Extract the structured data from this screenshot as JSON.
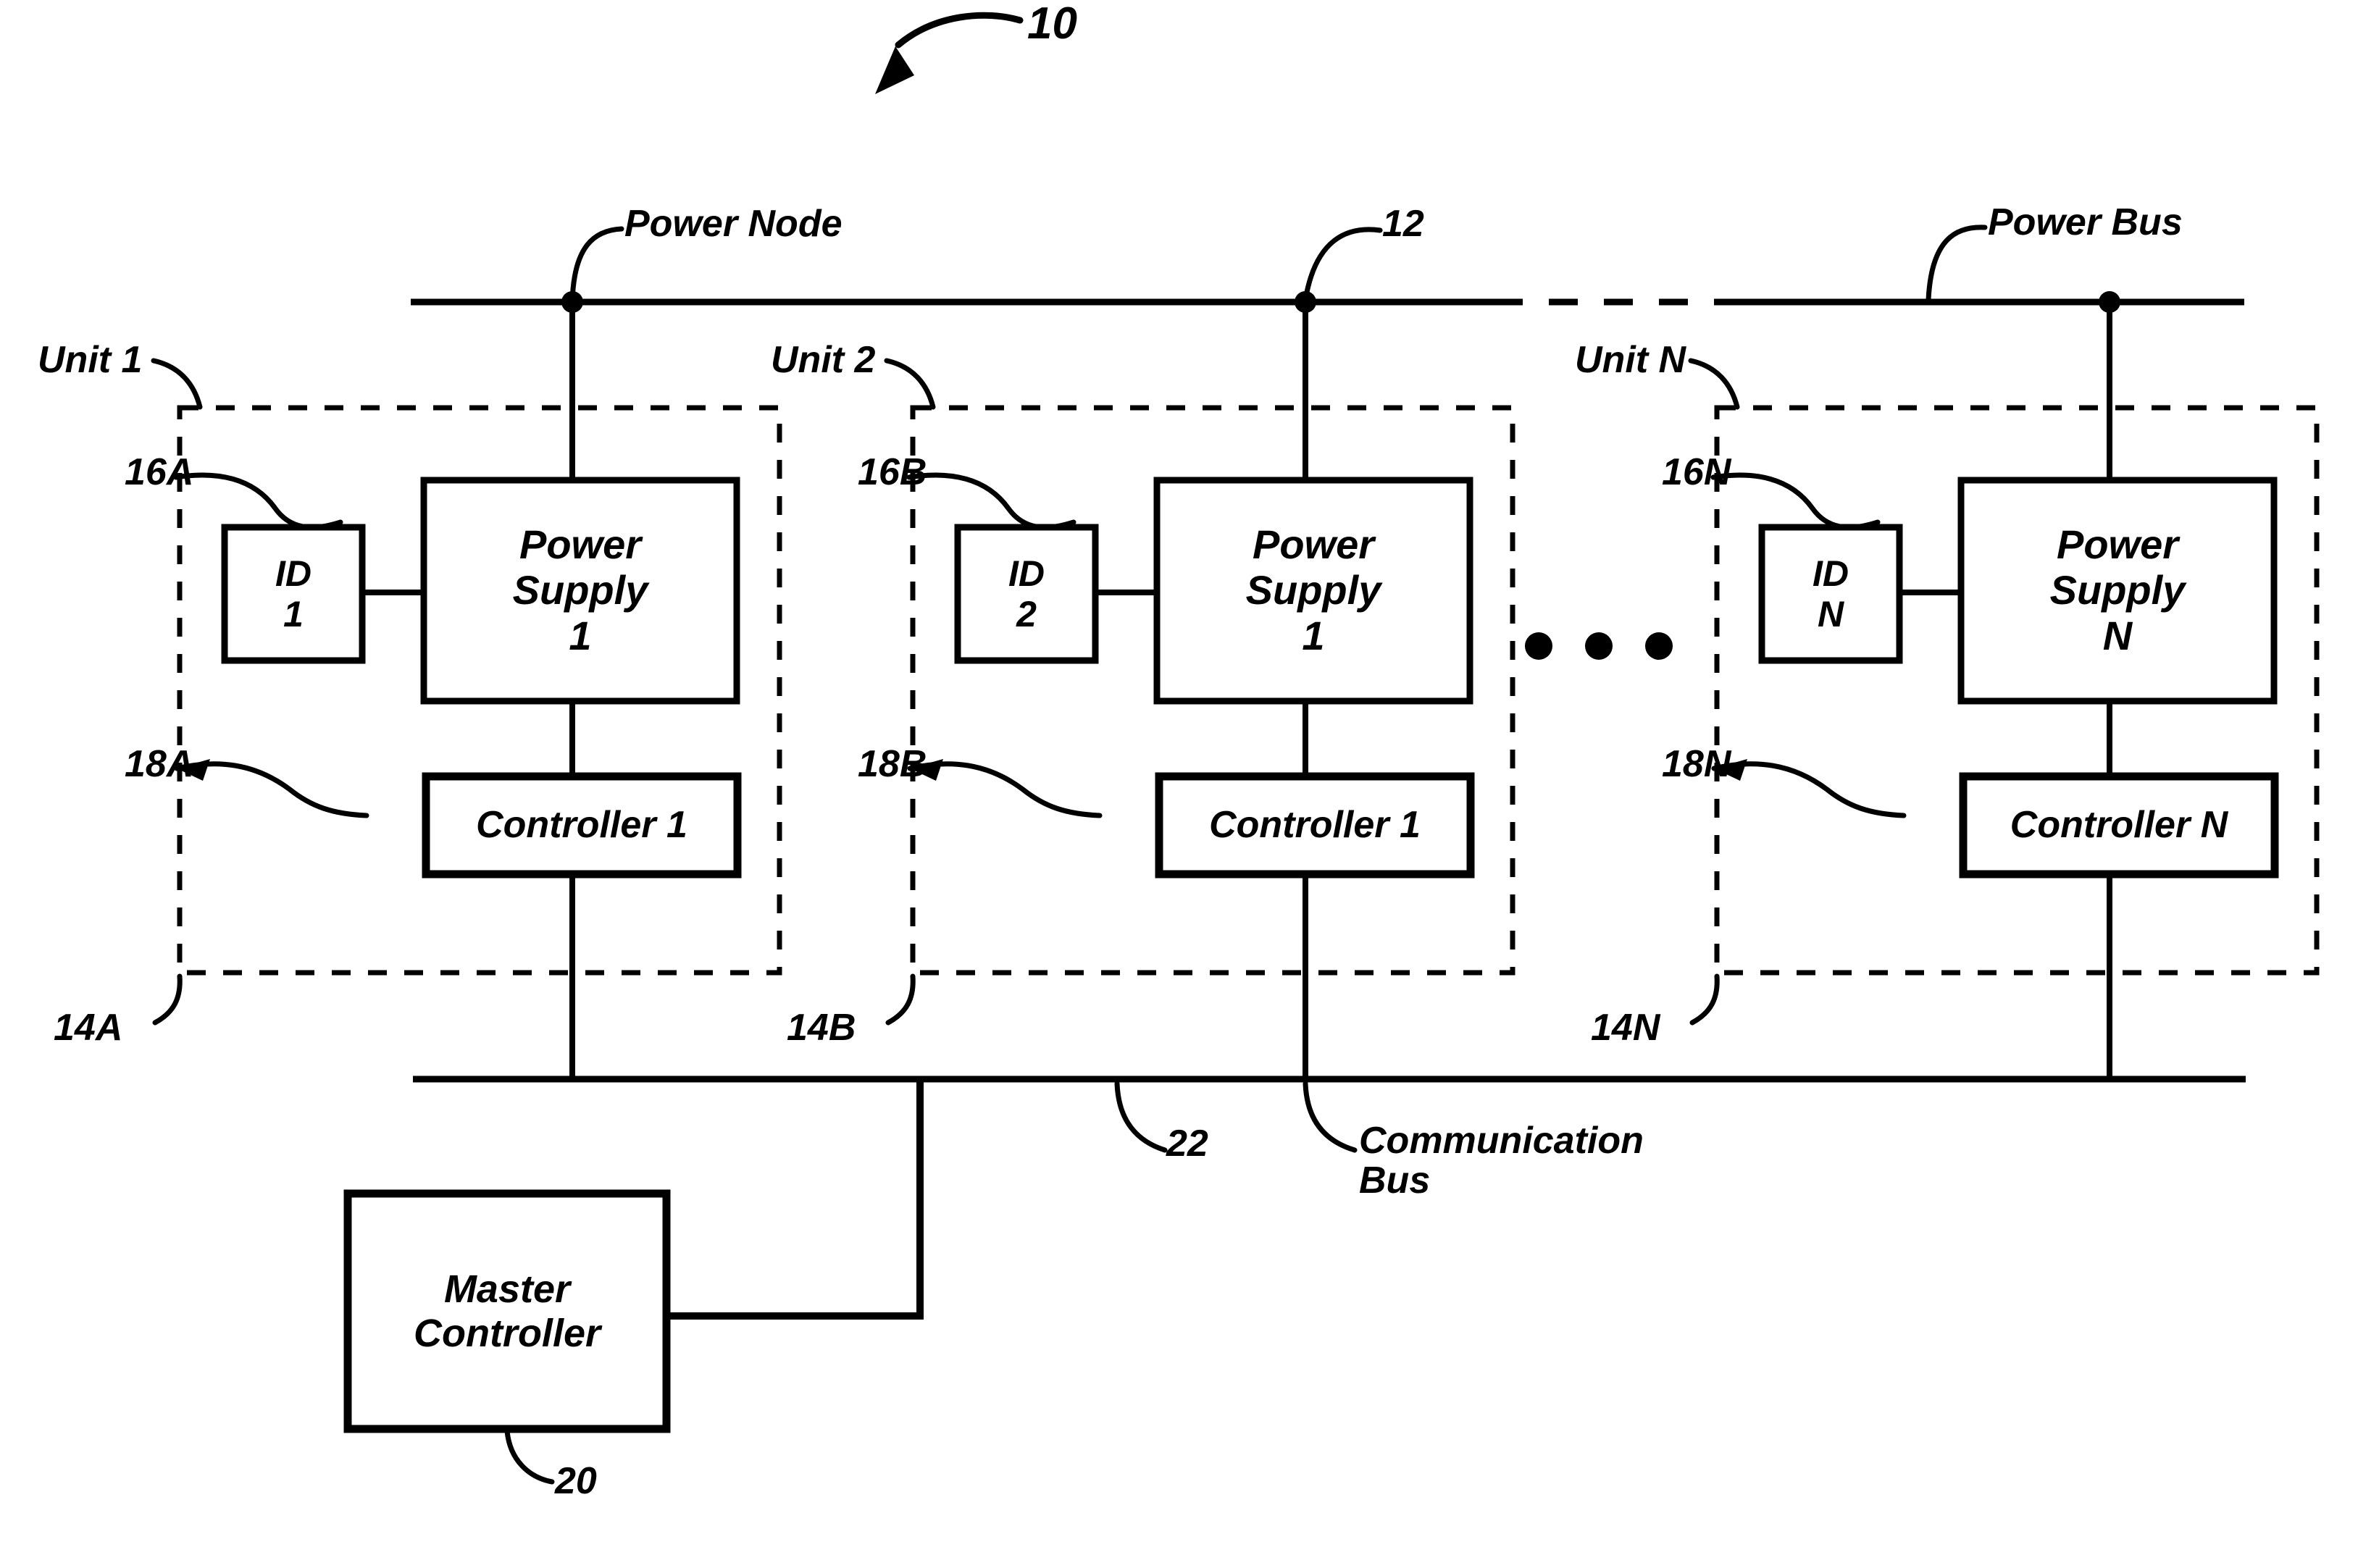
{
  "figure": {
    "number": "10",
    "power_bus_label": "Power Bus",
    "power_node_label": "Power Node",
    "power_bus_ref": "12",
    "comm_bus_label_line1": "Communication",
    "comm_bus_label_line2": "Bus",
    "comm_bus_ref": "22",
    "master_controller_line1": "Master",
    "master_controller_line2": "Controller",
    "master_controller_ref": "20",
    "ellipsis": "•"
  },
  "units": [
    {
      "unit_label": "Unit 1",
      "unit_ref": "14A",
      "power_supply_ref": "16A",
      "controller_ref": "18A",
      "id_line1": "ID",
      "id_line2": "1",
      "ps_line1": "Power",
      "ps_line2": "Supply",
      "ps_line3": "1",
      "controller_label": "Controller 1"
    },
    {
      "unit_label": "Unit 2",
      "unit_ref": "14B",
      "power_supply_ref": "16B",
      "controller_ref": "18B",
      "id_line1": "ID",
      "id_line2": "2",
      "ps_line1": "Power",
      "ps_line2": "Supply",
      "ps_line3": "1",
      "controller_label": "Controller 1"
    },
    {
      "unit_label": "Unit N",
      "unit_ref": "14N",
      "power_supply_ref": "16N",
      "controller_ref": "18N",
      "id_line1": "ID",
      "id_line2": "N",
      "ps_line1": "Power",
      "ps_line2": "Supply",
      "ps_line3": "N",
      "controller_label": "Controller N"
    }
  ],
  "colors": {
    "ink": "#000000",
    "paper": "#ffffff"
  }
}
